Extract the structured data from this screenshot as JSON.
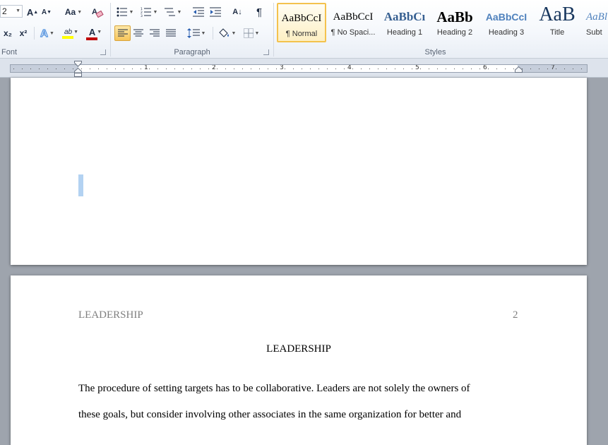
{
  "ribbon": {
    "font_group": {
      "label": "Font",
      "font_size": "2",
      "grow_font": "A",
      "shrink_font": "A",
      "change_case": "Aa",
      "clear_format": "A",
      "subscript": "x₂",
      "superscript": "x²",
      "text_effects": "A",
      "highlight": "ab",
      "font_color": "A"
    },
    "paragraph_group": {
      "label": "Paragraph",
      "sort": "A↓",
      "show_marks": "¶"
    },
    "styles_group": {
      "label": "Styles",
      "styles": [
        {
          "preview": "AaBbCcI",
          "name": "¶ Normal",
          "selected": true
        },
        {
          "preview": "AaBbCcI",
          "name": "¶ No Spaci...",
          "selected": false
        },
        {
          "preview": "AaBbCı",
          "name": "Heading 1",
          "selected": false
        },
        {
          "preview": "AaBb",
          "name": "Heading 2",
          "selected": false
        },
        {
          "preview": "AaBbCcI",
          "name": "Heading 3",
          "selected": false
        },
        {
          "preview": "AaB",
          "name": "Title",
          "selected": false
        },
        {
          "preview": "AaBl",
          "name": "Subt",
          "selected": false
        }
      ]
    }
  },
  "ruler": {
    "numbers": [
      "1",
      "2",
      "3",
      "4",
      "5",
      "6",
      "7"
    ]
  },
  "document": {
    "page2": {
      "running_head": "LEADERSHIP",
      "page_number": "2",
      "title": "LEADERSHIP",
      "lines": [
        "The procedure of setting targets has to be collaborative.  Leaders are not solely the owners of",
        "these goals, but consider involving  other associates in the same organization  for better and"
      ]
    }
  },
  "colors": {
    "workspace": "#9ea4ad",
    "selection": "#b3d2f2",
    "selected_style_border": "#f4c24d",
    "heading_blue": "#365f91",
    "font_color_red": "#c00000",
    "highlight_yellow": "#ffff00"
  }
}
